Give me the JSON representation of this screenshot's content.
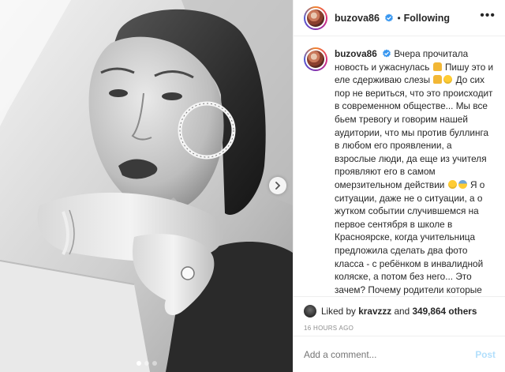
{
  "header": {
    "username": "buzova86",
    "separator": "•",
    "follow_label": "Following",
    "more_label": "•••"
  },
  "caption": {
    "username": "buzova86",
    "p1": "Вчера прочитала новость и ужаснулась",
    "p2": "Пишу это и еле сдерживаю слезы",
    "p3": "До сих пор не вериться, что это происходит в современном обществе... Мы все бьем тревогу и говорим нашей аудитории, что мы против буллинга в любом его проявлении, а взрослые люди, да еще из учителя проявляют его в самом омерзительном действии",
    "p4": "Я о ситуации, даже не о ситуации, а о жутком событии случившемся на первое сентября в школе в Красноярске, когда учительница предложила сделать два фото класса - с ребёнком в инвалидной коляске, а потом без него... Это зачем? Почему родители которые"
  },
  "likes": {
    "prefix": "Liked by",
    "user": "kravzzz",
    "and": "and",
    "count": "349,864 others"
  },
  "timestamp": "16 HOURS AGO",
  "comment_box": {
    "placeholder": "Add a comment...",
    "post_label": "Post"
  },
  "media": {
    "carousel_index": 1,
    "carousel_total": 3,
    "next_icon": "chevron-right-icon"
  },
  "colors": {
    "verified": "#3897f0",
    "post_disabled": "#b2dffc",
    "muted": "#8e8e8e"
  }
}
